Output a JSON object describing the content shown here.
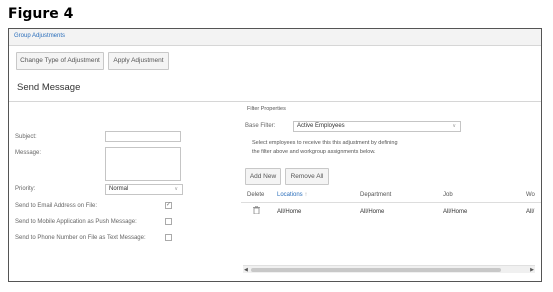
{
  "figure_title": "Figure 4",
  "header": {
    "link": "Group Adjustments"
  },
  "toolbar": {
    "change_type_label": "Change Type of Adjustment",
    "apply_label": "Apply Adjustment"
  },
  "section_title": "Send Message",
  "form": {
    "subject_label": "Subject:",
    "message_label": "Message:",
    "priority_label": "Priority:",
    "priority_value": "Normal",
    "email_label": "Send to Email Address on File:",
    "email_checked": true,
    "push_label": "Send to Mobile Application as Push Message:",
    "push_checked": false,
    "text_label": "Send to Phone Number on File as Text Message:",
    "text_checked": false
  },
  "filter": {
    "title": "Filter Properties",
    "base_filter_label": "Base Filter:",
    "base_filter_value": "Active Employees",
    "desc_line1": "Select employees to receive this this adjustment by defining",
    "desc_line2": "the filter above and workgroup assignments below.",
    "add_new_label": "Add New",
    "remove_all_label": "Remove All"
  },
  "grid": {
    "columns": [
      "Delete",
      "Locations",
      "Department",
      "Job",
      "Wo"
    ],
    "sort_indicator": "↑",
    "rows": [
      {
        "locations": "All/Home",
        "department": "All/Home",
        "job": "All/Home",
        "wo": "All/"
      }
    ]
  },
  "icons": {
    "delete": "trash-icon",
    "dropdown": "chevron-down-icon"
  }
}
